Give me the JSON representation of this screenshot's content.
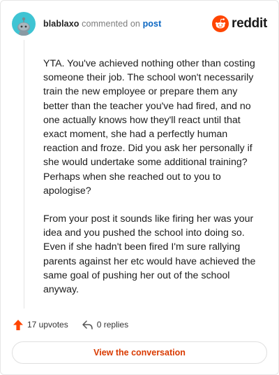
{
  "header": {
    "author": "blablaxo",
    "action": "commented on",
    "post_link": "post",
    "brand": "reddit"
  },
  "comment": {
    "paragraphs": [
      "YTA. You've achieved nothing other than costing someone their job. The school won't necessarily train the new employee or prepare them any better than the teacher you've had fired, and no one actually knows how they'll react until that exact moment, she had a perfectly human reaction and froze. Did you ask her personally if she would undertake some additional training? Perhaps when she reached out to you to apologise?",
      "From your post it sounds like firing her was your idea and you pushed the school into doing so. Even if she hadn't been fired I'm sure rallying parents against her etc would have achieved the same goal of pushing her out of the school anyway."
    ]
  },
  "footer": {
    "upvotes": "17 upvotes",
    "replies": "0 replies",
    "cta": "View the conversation"
  },
  "colors": {
    "accent": "#ff4500",
    "link": "#0a66c2",
    "cta_text": "#d93a00",
    "avatar_bg": "#3fc4d3"
  },
  "icons": {
    "avatar": "snoo-avatar-icon",
    "brand": "reddit-logo-icon",
    "upvote": "upvote-arrow-icon",
    "reply": "reply-arrow-icon"
  }
}
